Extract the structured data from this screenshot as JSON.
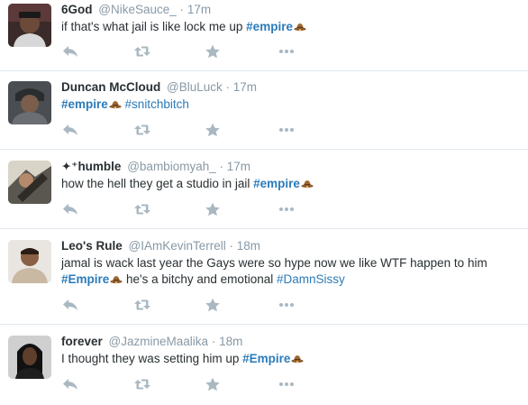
{
  "colors": {
    "link": "#2b7bb9",
    "muted": "#8899a6",
    "icon": "#aab8c2",
    "divider": "#e1e8ed",
    "text": "#292f33"
  },
  "icons": {
    "reply": "reply-icon",
    "retweet": "retweet-icon",
    "favorite": "star-icon",
    "more": "more-icon",
    "emoji": "cowboy-hat-emoji-icon"
  },
  "tweets": [
    {
      "name": "6God",
      "handle": "@NikeSauce_",
      "dot": "·",
      "time": "17m",
      "text_1": "if that's what jail is like lock me up ",
      "tag_1": "#empire"
    },
    {
      "name": "Duncan McCloud",
      "handle": "@BluLuck",
      "dot": "·",
      "time": "17m",
      "tag_1": "#empire",
      "tag_2": "#snitchbitch"
    },
    {
      "name_glyph": "✦⁺",
      "name": "humble",
      "handle": "@bambiomyah_",
      "dot": "·",
      "time": "17m",
      "text_1": "how the hell they get a studio in jail ",
      "tag_1": "#empire"
    },
    {
      "name": "Leo's Rule",
      "handle": "@IAmKevinTerrell",
      "dot": "·",
      "time": "18m",
      "text_1": "jamal is wack last year the Gays were so hype now we like WTF happen to him",
      "tag_1": "#Empire",
      "text_2": " he's a bitchy and emotional ",
      "tag_2": "#DamnSissy"
    },
    {
      "name": "forever",
      "handle": "@JazmineMaalika",
      "dot": "·",
      "time": "18m",
      "text_1": "I thought they was setting him up ",
      "tag_1": "#Empire"
    }
  ]
}
